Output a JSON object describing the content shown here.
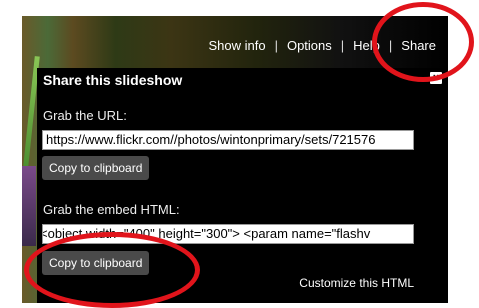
{
  "nav": {
    "show_info": "Show info",
    "options": "Options",
    "help": "Help",
    "share": "Share",
    "separator": "|"
  },
  "panel": {
    "title": "Share this slideshow",
    "close_icon": "close-icon"
  },
  "url_section": {
    "label": "Grab the URL:",
    "value": "https://www.flickr.com//photos/wintonprimary/sets/721576",
    "copy_label": "Copy to clipboard"
  },
  "embed_section": {
    "label": "Grab the embed HTML:",
    "value": "<object width=\"400\" height=\"300\"> <param name=\"flashv",
    "copy_label": "Copy to clipboard",
    "customize_label": "Customize this HTML"
  },
  "colors": {
    "annotation": "#e1141b",
    "panel_bg": "#000000",
    "button_bg": "#4a4a4a"
  }
}
